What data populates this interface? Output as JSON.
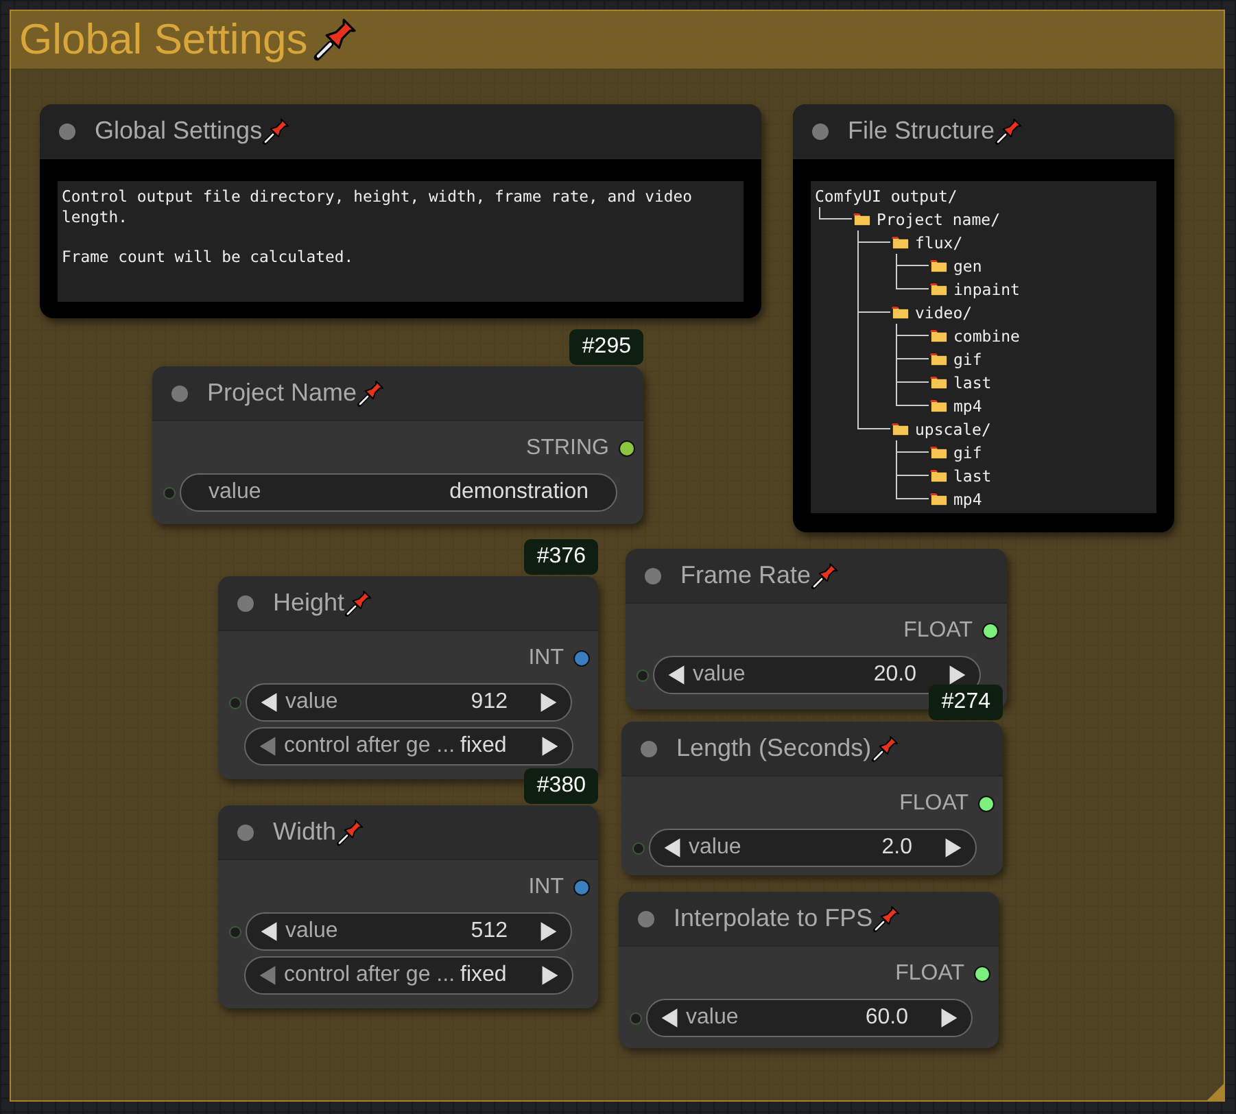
{
  "group": {
    "title": "Global Settings"
  },
  "note": {
    "title": "Global Settings",
    "text": "Control output file directory, height, width, frame rate, and video length.\n\nFrame count will be calculated."
  },
  "file_structure": {
    "title": "File Structure",
    "tree": {
      "label": "ComfyUI output/",
      "children": [
        {
          "label": "Project name/",
          "children": [
            {
              "label": "flux/",
              "children": [
                {
                  "label": "gen"
                },
                {
                  "label": "inpaint"
                }
              ]
            },
            {
              "label": "video/",
              "children": [
                {
                  "label": "combine"
                },
                {
                  "label": "gif"
                },
                {
                  "label": "last"
                },
                {
                  "label": "mp4"
                }
              ]
            },
            {
              "label": "upscale/",
              "children": [
                {
                  "label": "gif"
                },
                {
                  "label": "last"
                },
                {
                  "label": "mp4"
                }
              ]
            }
          ]
        }
      ]
    }
  },
  "nodes": [
    {
      "title": "Project Name",
      "badge": "#295",
      "output": {
        "label": "STRING",
        "color": "#8cc63f"
      },
      "widgets": [
        {
          "kind": "text",
          "label": "value",
          "value": "demonstration"
        }
      ]
    },
    {
      "title": "Height",
      "badge": "#376",
      "output": {
        "label": "INT",
        "color": "#3a7fc0"
      },
      "widgets": [
        {
          "kind": "number",
          "label": "value",
          "value": "912",
          "prev_disabled": false
        },
        {
          "kind": "combo",
          "label": "control after ge ...",
          "value": "fixed",
          "prev_disabled": true
        }
      ]
    },
    {
      "title": "Width",
      "badge": "#380",
      "output": {
        "label": "INT",
        "color": "#3a7fc0"
      },
      "widgets": [
        {
          "kind": "number",
          "label": "value",
          "value": "512",
          "prev_disabled": false
        },
        {
          "kind": "combo",
          "label": "control after ge ...",
          "value": "fixed",
          "prev_disabled": true
        }
      ]
    },
    {
      "title": "Frame Rate",
      "output": {
        "label": "FLOAT",
        "color": "#7cf07c"
      },
      "widgets": [
        {
          "kind": "number",
          "label": "value",
          "value": "20.0",
          "prev_disabled": false
        }
      ]
    },
    {
      "title": "Length (Seconds)",
      "badge": "#274",
      "output": {
        "label": "FLOAT",
        "color": "#7cf07c"
      },
      "widgets": [
        {
          "kind": "number",
          "label": "value",
          "value": "2.0",
          "prev_disabled": false
        }
      ]
    },
    {
      "title": "Interpolate to FPS",
      "output": {
        "label": "FLOAT",
        "color": "#7cf07c"
      },
      "widgets": [
        {
          "kind": "number",
          "label": "value",
          "value": "60.0",
          "prev_disabled": false
        }
      ]
    }
  ]
}
